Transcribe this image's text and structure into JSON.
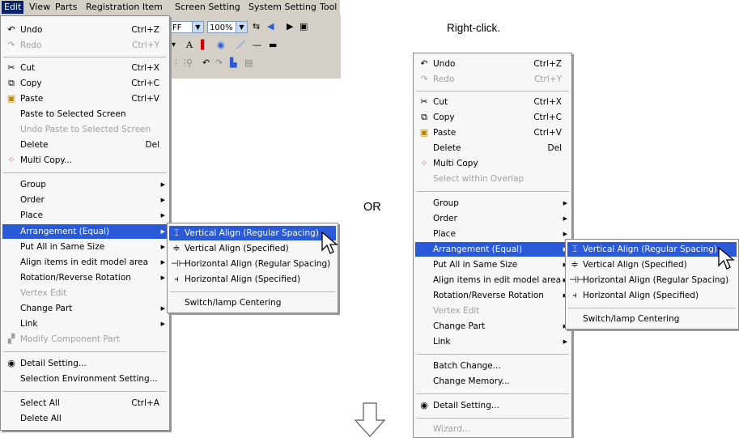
{
  "menubar": {
    "items": [
      "Edit",
      "View",
      "Parts",
      "Registration Item",
      "Screen Setting",
      "System Setting",
      "Tool"
    ]
  },
  "toolbar": {
    "combo1_value": "FF",
    "zoom_value": "100%",
    "font_glyph": "A"
  },
  "caption": "Right-click.",
  "or_label": "OR",
  "edit_menu": {
    "items": [
      {
        "label": "Undo",
        "shortcut": "Ctrl+Z",
        "icon": "undo-icon"
      },
      {
        "label": "Redo",
        "shortcut": "Ctrl+Y",
        "icon": "redo-icon",
        "disabled": true
      },
      {
        "label": "Cut",
        "shortcut": "Ctrl+X",
        "icon": "scissors-icon"
      },
      {
        "label": "Copy",
        "shortcut": "Ctrl+C",
        "icon": "copy-icon"
      },
      {
        "label": "Paste",
        "shortcut": "Ctrl+V",
        "icon": "paste-icon"
      },
      {
        "label": "Paste to Selected Screen"
      },
      {
        "label": "Undo Paste to Selected Screen",
        "disabled": true
      },
      {
        "label": "Delete",
        "shortcut": "Del"
      },
      {
        "label": "Multi Copy...",
        "icon": "multi-copy-icon"
      },
      {
        "label": "Group",
        "submenu": true
      },
      {
        "label": "Order",
        "submenu": true
      },
      {
        "label": "Place",
        "submenu": true
      },
      {
        "label": "Arrangement (Equal)",
        "submenu": true,
        "highlighted": true
      },
      {
        "label": "Put All in Same Size",
        "submenu": true
      },
      {
        "label": "Align items in edit model area",
        "submenu": true
      },
      {
        "label": "Rotation/Reverse Rotation",
        "submenu": true
      },
      {
        "label": "Vertex Edit",
        "disabled": true
      },
      {
        "label": "Change Part",
        "submenu": true
      },
      {
        "label": "Link",
        "submenu": true
      },
      {
        "label": "Modify Component Part",
        "disabled": true,
        "icon": "component-icon"
      },
      {
        "label": "Detail Setting...",
        "icon": "detail-setting-icon"
      },
      {
        "label": "Selection Environment Setting..."
      },
      {
        "label": "Select All",
        "shortcut": "Ctrl+A"
      },
      {
        "label": "Delete All"
      }
    ]
  },
  "edit_submenu": {
    "items": [
      {
        "label": "Vertical Align (Regular Spacing)",
        "icon": "vertical-align-regular-icon",
        "highlighted": true
      },
      {
        "label": "Vertical Align (Specified)",
        "icon": "vertical-align-specified-icon"
      },
      {
        "label": "Horizontal Align (Regular Spacing)",
        "icon": "horizontal-align-regular-icon"
      },
      {
        "label": "Horizontal Align (Specified)",
        "icon": "horizontal-align-specified-icon"
      },
      {
        "label": "Switch/lamp Centering"
      }
    ]
  },
  "context_menu": {
    "items": [
      {
        "label": "Undo",
        "shortcut": "Ctrl+Z",
        "icon": "undo-icon"
      },
      {
        "label": "Redo",
        "shortcut": "Ctrl+Y",
        "icon": "redo-icon",
        "disabled": true
      },
      {
        "label": "Cut",
        "shortcut": "Ctrl+X",
        "icon": "scissors-icon"
      },
      {
        "label": "Copy",
        "shortcut": "Ctrl+C",
        "icon": "copy-icon"
      },
      {
        "label": "Paste",
        "shortcut": "Ctrl+V",
        "icon": "paste-icon"
      },
      {
        "label": "Delete",
        "shortcut": "Del"
      },
      {
        "label": "Multi Copy",
        "icon": "multi-copy-icon"
      },
      {
        "label": "Select within Overlap",
        "disabled": true
      },
      {
        "label": "Group",
        "submenu": true
      },
      {
        "label": "Order",
        "submenu": true
      },
      {
        "label": "Place",
        "submenu": true
      },
      {
        "label": "Arrangement (Equal)",
        "submenu": true,
        "highlighted": true
      },
      {
        "label": "Put All in Same Size",
        "submenu": true
      },
      {
        "label": "Align items in edit model area",
        "submenu": true
      },
      {
        "label": "Rotation/Reverse Rotation",
        "submenu": true
      },
      {
        "label": "Vertex Edit",
        "disabled": true
      },
      {
        "label": "Change Part",
        "submenu": true
      },
      {
        "label": "Link",
        "submenu": true
      },
      {
        "label": "Batch Change..."
      },
      {
        "label": "Change Memory..."
      },
      {
        "label": "Detail Setting...",
        "icon": "detail-setting-icon"
      },
      {
        "label": "Wizard...",
        "disabled": true
      }
    ]
  },
  "context_submenu": {
    "items": [
      {
        "label": "Vertical Align (Regular Spacing)",
        "icon": "vertical-align-regular-icon",
        "highlighted": true
      },
      {
        "label": "Vertical Align (Specified)",
        "icon": "vertical-align-specified-icon"
      },
      {
        "label": "Horizontal Align (Regular Spacing)",
        "icon": "horizontal-align-regular-icon"
      },
      {
        "label": "Horizontal Align (Specified)",
        "icon": "horizontal-align-specified-icon"
      },
      {
        "label": "Switch/lamp Centering"
      }
    ]
  },
  "colors": {
    "highlight": "#2a5ad7",
    "menubar_active": "#0a246a",
    "menu_bg": "#f7f7f7",
    "disabled_text": "#a0a0a0"
  }
}
